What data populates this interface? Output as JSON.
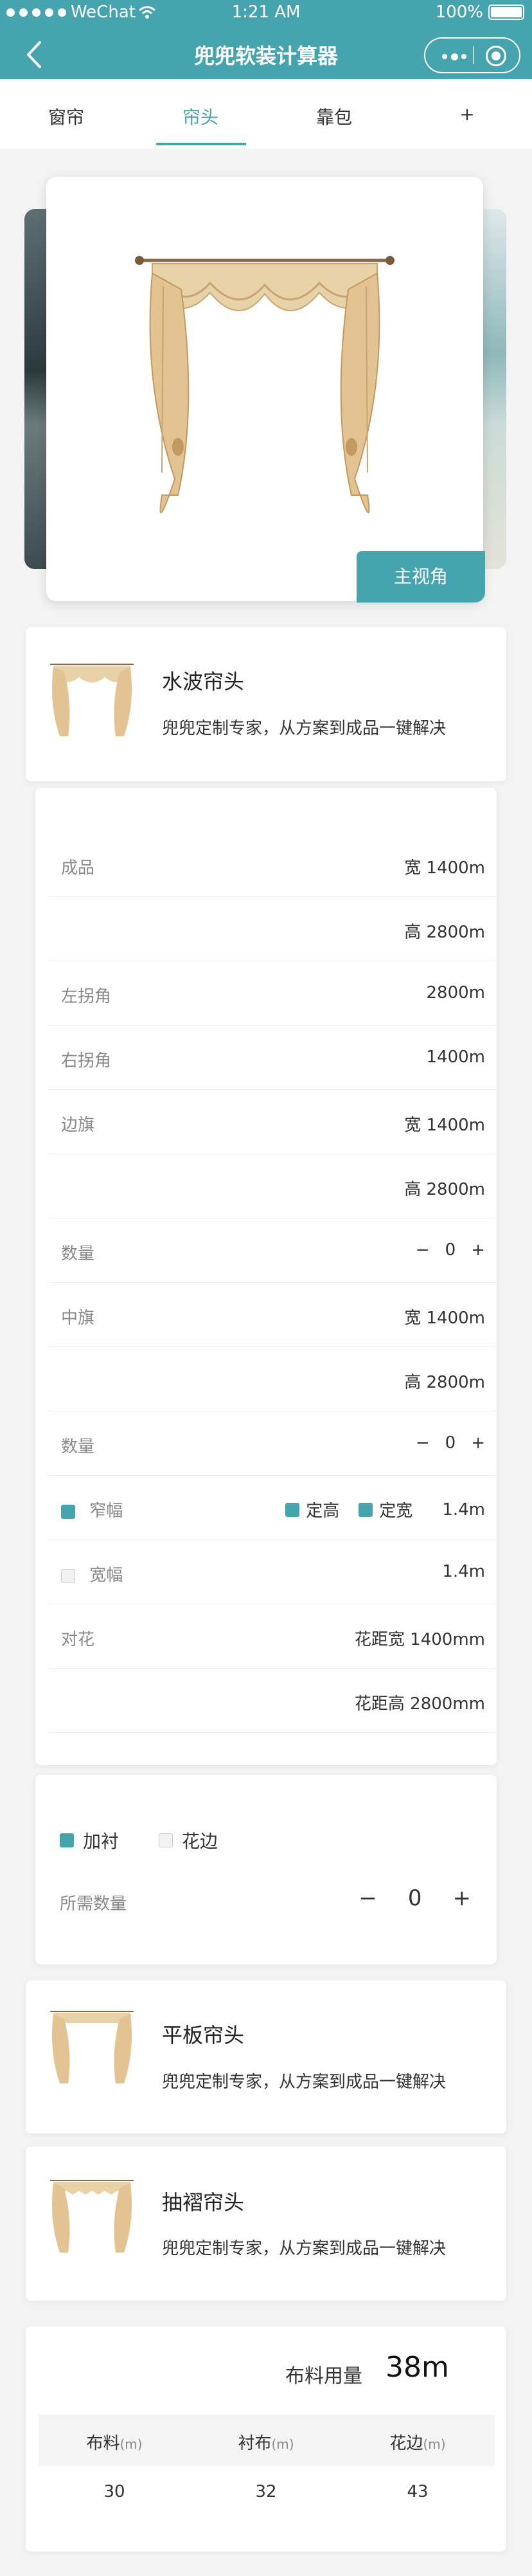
{
  "status_bar": {
    "carrier": "WeChat",
    "time": "1:21 AM",
    "battery": "100%"
  },
  "nav": {
    "title": "兜兜软装计算器"
  },
  "tabs": [
    {
      "label": "窗帘",
      "active": false
    },
    {
      "label": "帘头",
      "active": true
    },
    {
      "label": "靠包",
      "active": false
    },
    {
      "label": "+",
      "active": false
    }
  ],
  "hero": {
    "button": "主视角"
  },
  "products": [
    {
      "name": "水波帘头",
      "desc": "兜兜定制专家，从方案到成品一键解决"
    },
    {
      "name": "平板帘头",
      "desc": "兜兜定制专家，从方案到成品一键解决"
    },
    {
      "name": "抽褶帘头",
      "desc": "兜兜定制专家，从方案到成品一键解决"
    }
  ],
  "spec": {
    "finished_label": "成品",
    "finished_width": "宽 1400m",
    "finished_height": "高 2800m",
    "left_corner_label": "左拐角",
    "left_corner_value": "2800m",
    "right_corner_label": "右拐角",
    "right_corner_value": "1400m",
    "side_flag_label": "边旗",
    "side_flag_width": "宽 1400m",
    "side_flag_height": "高 2800m",
    "qty_label": "数量",
    "qty1": "0",
    "middle_flag_label": "中旗",
    "middle_flag_width": "宽 1400m",
    "middle_flag_height": "高 2800m",
    "qty2": "0",
    "minus": "−",
    "plus": "+",
    "narrow_label": "窄幅",
    "fixed_height": "定高",
    "fixed_width": "定宽",
    "narrow_value": "1.4m",
    "wide_label": "宽幅",
    "wide_value": "1.4m",
    "pattern_label": "对花",
    "pattern_width": "花距宽 1400mm",
    "pattern_height": "花距高 2800mm"
  },
  "extras": {
    "lining": "加衬",
    "lace": "花边",
    "need_qty_label": "所需数量",
    "need_qty": "0"
  },
  "summary": {
    "usage_label": "布料用量",
    "usage_value": "38m",
    "columns": [
      {
        "label": "布料",
        "unit": "(m)",
        "value": "30"
      },
      {
        "label": "衬布",
        "unit": "(m)",
        "value": "32"
      },
      {
        "label": "花边",
        "unit": "(m)",
        "value": "43"
      }
    ]
  },
  "colors": {
    "accent": "#46a4ae",
    "background": "#f3f3f3"
  }
}
